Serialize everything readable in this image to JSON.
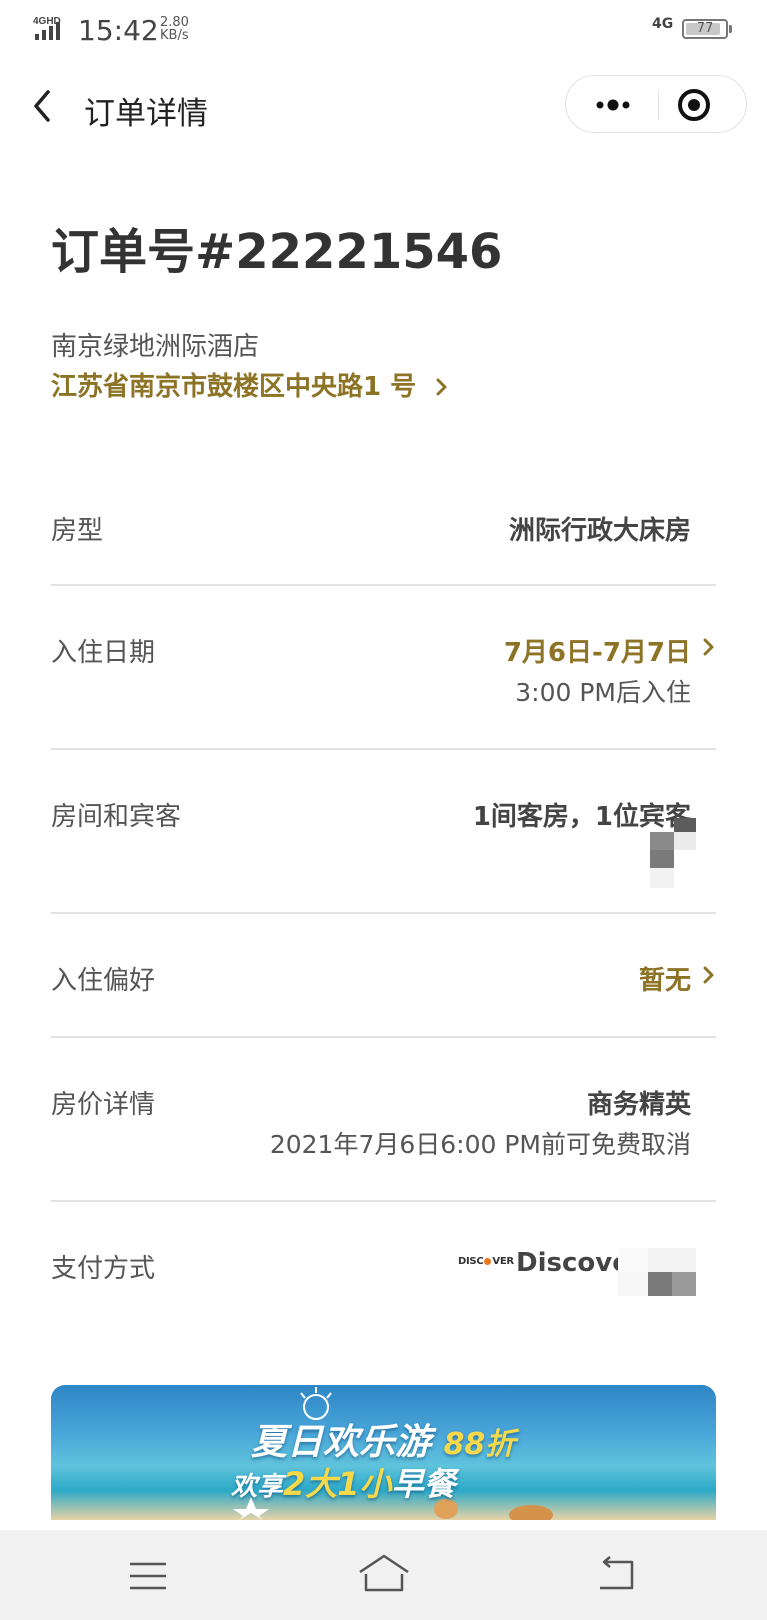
{
  "status_bar": {
    "network": "4G",
    "signal_tag": "4GHD",
    "time": "15:42",
    "speed_value": "2.80",
    "speed_unit": "KB/s",
    "battery": "77"
  },
  "nav": {
    "title": "订单详情"
  },
  "order": {
    "number_text": "订单号#22221546",
    "hotel_name": "南京绿地洲际酒店",
    "address": "江苏省南京市鼓楼区中央路1 号"
  },
  "rows": {
    "room_type": {
      "label": "房型",
      "value": "洲际行政大床房"
    },
    "checkin": {
      "label": "入住日期",
      "value": "7月6日-7月7日",
      "sub": "3:00 PM后入住"
    },
    "rooms_guests": {
      "label": "房间和宾客",
      "value": "1间客房，1位宾客"
    },
    "preference": {
      "label": "入住偏好",
      "value": "暂无"
    },
    "price": {
      "label": "房价详情",
      "value": "商务精英",
      "sub": "2021年7月6日6:00 PM前可免费取消"
    },
    "payment": {
      "label": "支付方式",
      "card_brand": "Discover",
      "logo_text": "DISCOVER"
    }
  },
  "banner": {
    "line1": "夏日欢乐游",
    "line1_discount": "88折",
    "line2_prefix": "欢享",
    "line2_highlight": "2大1小",
    "line2_suffix": "早餐"
  },
  "colors": {
    "accent_gold": "#8c7325",
    "divider": "#e2e2e2",
    "text_main": "#333333"
  }
}
